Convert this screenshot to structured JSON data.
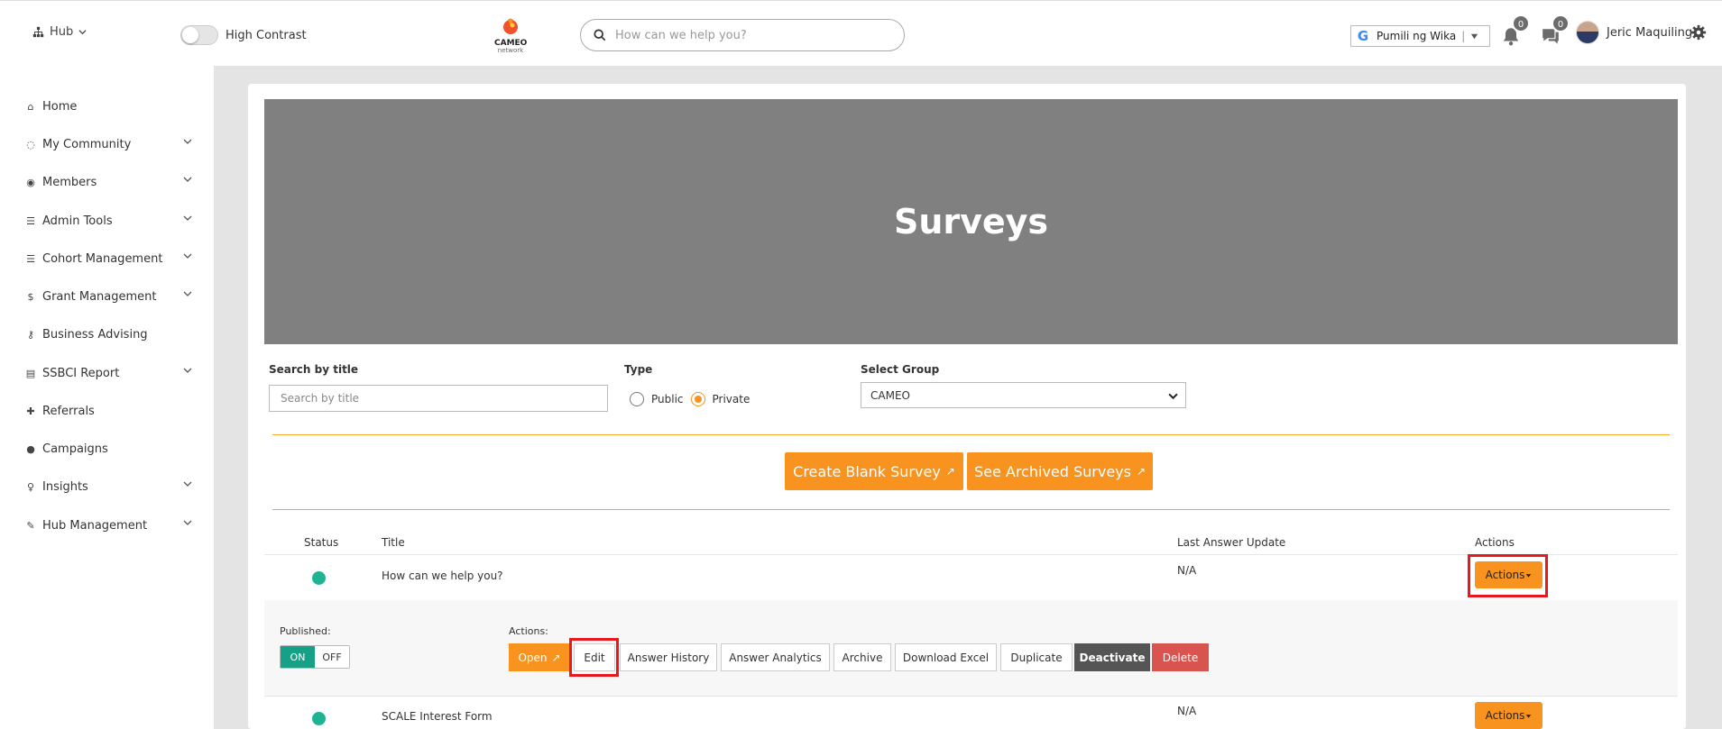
{
  "header": {
    "hub_label": "Hub",
    "contrast_label": "High Contrast",
    "logo_text": "CAMEO",
    "logo_sub": "network",
    "search_placeholder": "How can we help you?",
    "language_label": "Pumili ng Wika",
    "notifications_count": "0",
    "messages_count": "0",
    "user_name": "Jeric Maquiling"
  },
  "sidebar": {
    "items": [
      {
        "label": "Home",
        "icon": "home-icon"
      },
      {
        "label": "My Community",
        "icon": "community-icon"
      },
      {
        "label": "Members",
        "icon": "user-circle-icon"
      },
      {
        "label": "Admin Tools",
        "icon": "list-icon"
      },
      {
        "label": "Cohort Management",
        "icon": "list-icon"
      },
      {
        "label": "Grant Management",
        "icon": "dollar-icon"
      },
      {
        "label": "Business Advising",
        "icon": "key-icon"
      },
      {
        "label": "SSBCI Report",
        "icon": "file-icon"
      },
      {
        "label": "Referrals",
        "icon": "user-plus-icon"
      },
      {
        "label": "Campaigns",
        "icon": "comment-icon"
      },
      {
        "label": "Insights",
        "icon": "lightbulb-icon"
      },
      {
        "label": "Hub Management",
        "icon": "wrench-icon"
      }
    ]
  },
  "page": {
    "title": "Surveys",
    "search_label": "Search by title",
    "search_placeholder": "Search by title",
    "type_label": "Type",
    "type_public": "Public",
    "type_private": "Private",
    "group_label": "Select Group",
    "group_value": "CAMEO",
    "create_button": "Create Blank Survey",
    "archived_button": "See Archived Surveys",
    "arrow_glyph": "↗"
  },
  "table": {
    "headers": {
      "status": "Status",
      "title": "Title",
      "last_update": "Last Answer Update",
      "actions": "Actions"
    },
    "rows": [
      {
        "title": "How can we help you?",
        "last_update": "N/A",
        "actions_label": "Actions"
      },
      {
        "title": "SCALE Interest Form",
        "last_update": "N/A",
        "actions_label": "Actions"
      }
    ],
    "expanded": {
      "published_label": "Published:",
      "on_label": "ON",
      "off_label": "OFF",
      "actions_label": "Actions:",
      "buttons": {
        "open": "Open",
        "edit": "Edit",
        "answer_history": "Answer History",
        "answer_analytics": "Answer Analytics",
        "archive": "Archive",
        "download_excel": "Download Excel",
        "duplicate": "Duplicate",
        "deactivate": "Deactivate",
        "delete": "Delete"
      }
    }
  },
  "colors": {
    "accent": "#f7931e",
    "status": "#1fb394",
    "published_on": "#16a085",
    "delete": "#d9534f",
    "highlight": "#e8181e",
    "banner": "#808080"
  }
}
